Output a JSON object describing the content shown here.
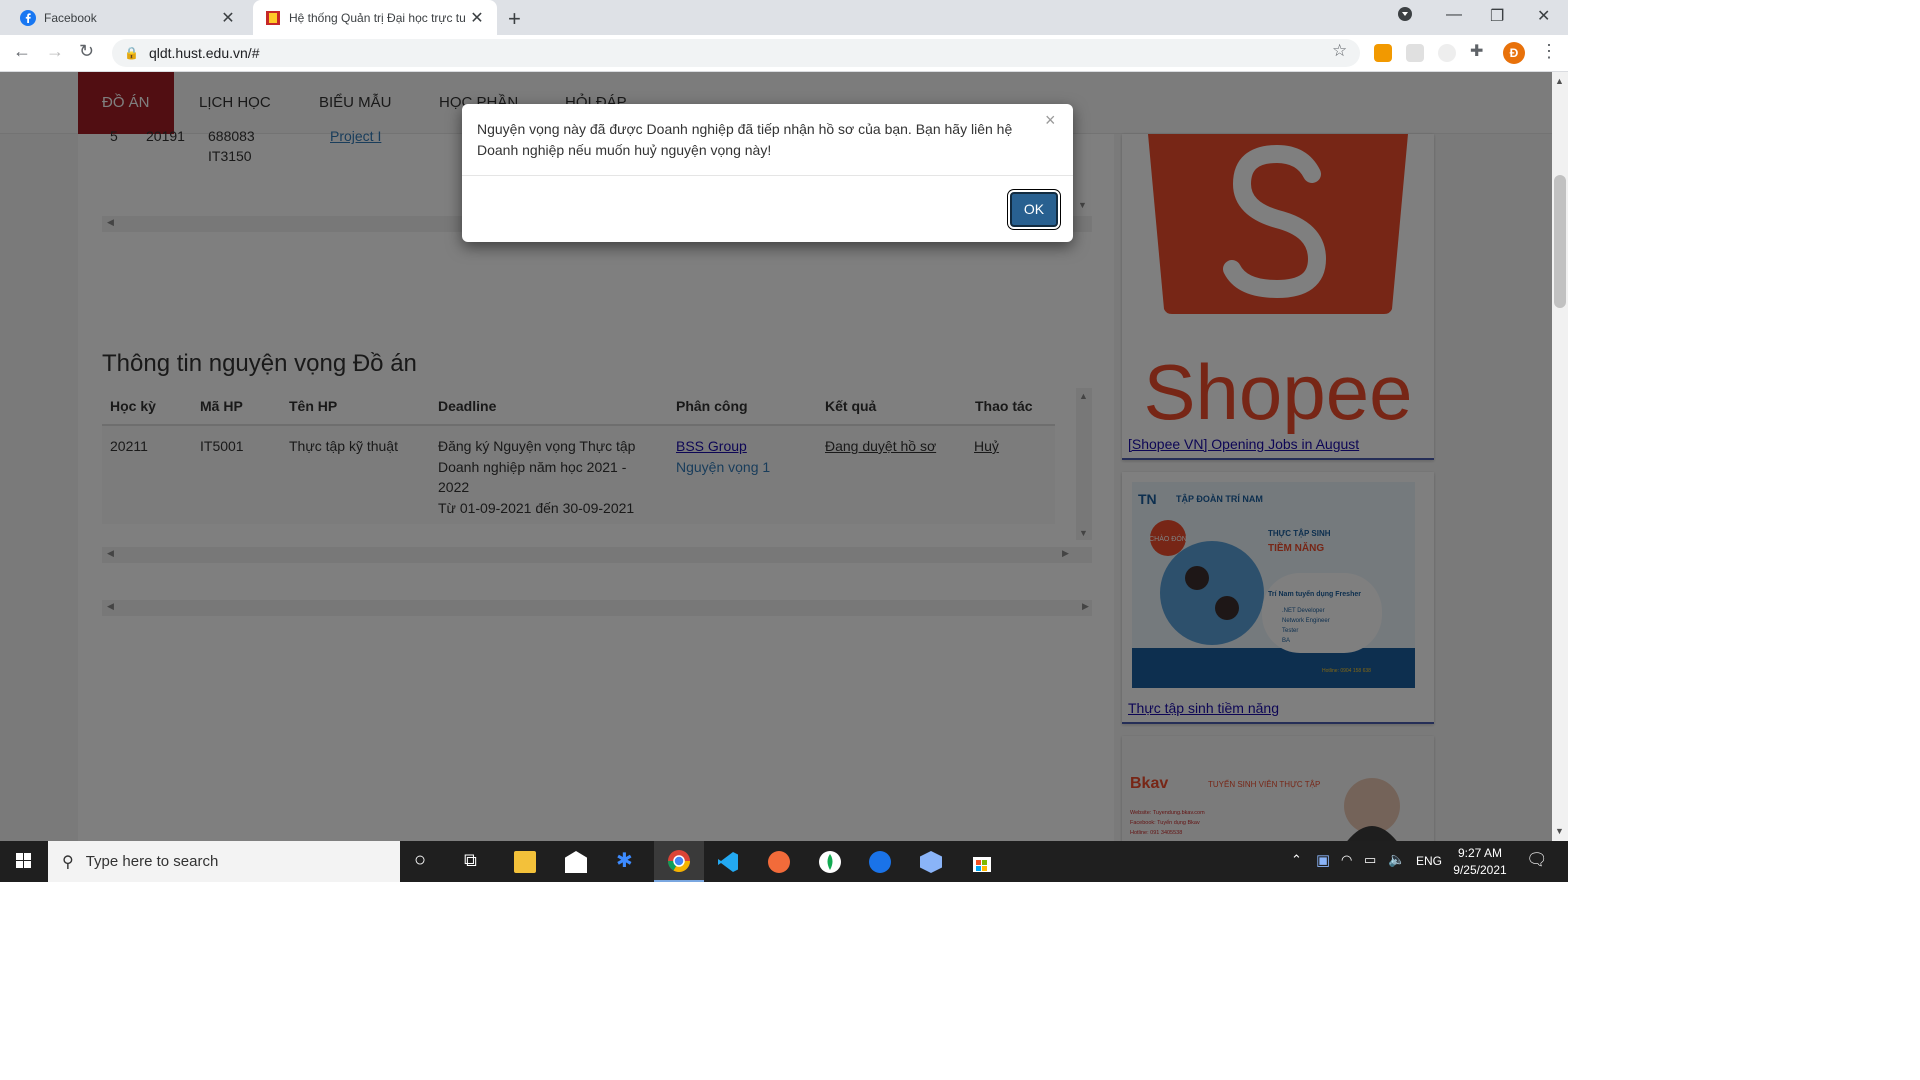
{
  "browser": {
    "tabs": [
      {
        "title": "Facebook",
        "active": false
      },
      {
        "title": "Hệ thống Quản trị Đại học trực tu",
        "active": true
      }
    ],
    "url": "qldt.hust.edu.vn/#",
    "profile_initial": "Đ"
  },
  "nav": {
    "items": [
      "ĐỒ ÁN",
      "LỊCH HỌC",
      "BIỂU MẪU",
      "HỌC PHẦN",
      "HỎI ĐÁP"
    ],
    "active": "ĐỒ ÁN"
  },
  "previous_table_row": {
    "index": "5",
    "semester": "20191",
    "code_line1": "688083",
    "code_line2": "IT3150",
    "name": "Project I"
  },
  "section": {
    "title": "Thông tin nguyện vọng Đồ án"
  },
  "table": {
    "headers": [
      "Học kỳ",
      "Mã HP",
      "Tên HP",
      "Deadline",
      "Phân công",
      "Kết quả",
      "Thao tác"
    ],
    "rows": [
      {
        "semester": "20211",
        "code": "IT5001",
        "name": "Thực tập kỹ thuật",
        "deadline_line1": "Đăng ký Nguyện vọng Thực tập",
        "deadline_line2": "Doanh nghiệp năm học 2021 -",
        "deadline_line3": "2022",
        "deadline_line4": "Từ 01-09-2021 đến 30-09-2021",
        "assignment": "BSS Group",
        "assignment_sub": "Nguyện vọng 1",
        "result": "Đang duyệt hồ sơ",
        "action": "Huỷ"
      }
    ]
  },
  "sidebar": {
    "cards": [
      {
        "caption": "[Shopee VN] Opening Jobs in August",
        "logo_text": "Shopee",
        "logo_color": "#ee4d2d"
      },
      {
        "caption": "Thực tập sinh tiềm năng",
        "banner_brand": "TẬP ĐOÀN TRÍ NAM",
        "banner_logo": "TN",
        "banner_heading": "THỰC TẬP SINH",
        "banner_heading2": "TIỀM NĂNG",
        "banner_badge": "CHÀO ĐÓN",
        "banner_subtitle": "Trí Nam tuyển dụng Fresher",
        "banner_roles": [
          ".NET Developer",
          "Network Engineer",
          "Tester",
          "BA"
        ],
        "banner_hotline": "Hotline: 0904 158 638"
      },
      {
        "caption": "",
        "banner_brand": "Bkav",
        "banner_heading": "TUYỂN SINH VIÊN THỰC TẬP",
        "banner_website": "Website: Tuyendung.bkav.com",
        "banner_facebook": "Facebook: Tuyển dụng Bkav",
        "banner_hotline": "Hotline: 091 3405538"
      }
    ]
  },
  "modal": {
    "message": "Nguyện vọng này đã được Doanh nghiệp đã tiếp nhận hồ sơ của bạn. Bạn hãy liên hệ Doanh nghiệp nếu muốn huỷ nguyện vọng này!",
    "close": "×",
    "ok_label": "OK"
  },
  "taskbar": {
    "search_placeholder": "Type here to search",
    "language": "ENG",
    "time": "9:27 AM",
    "date": "9/25/2021"
  },
  "colors": {
    "nav_active": "#a31d24",
    "link": "#337ab7",
    "ok_button": "#286090"
  }
}
